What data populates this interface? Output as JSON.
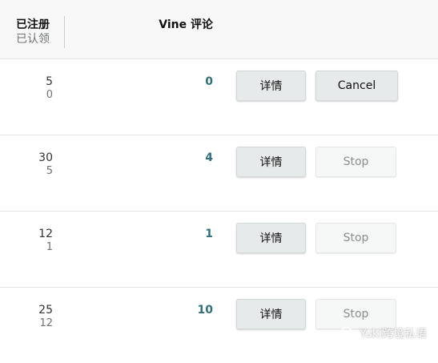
{
  "header": {
    "registered_label": "已注册",
    "claimed_label": "已认领",
    "vine_reviews_label": "Vine 评论"
  },
  "rows": [
    {
      "registered": "5",
      "claimed": "0",
      "vine_reviews": "0",
      "details_label": "详情",
      "action_label": "Cancel",
      "action_enabled": true
    },
    {
      "registered": "30",
      "claimed": "5",
      "vine_reviews": "4",
      "details_label": "详情",
      "action_label": "Stop",
      "action_enabled": false
    },
    {
      "registered": "12",
      "claimed": "1",
      "vine_reviews": "1",
      "details_label": "详情",
      "action_label": "Stop",
      "action_enabled": false
    },
    {
      "registered": "25",
      "claimed": "12",
      "vine_reviews": "10",
      "details_label": "详情",
      "action_label": "Stop",
      "action_enabled": false
    }
  ],
  "watermark": {
    "text": "Yuki跨境私语",
    "icon": "wechat-icon"
  },
  "colors": {
    "vine_count": "#2f6f80",
    "header_bg": "#f8f8f8",
    "button_bg": "#e6eaeb"
  }
}
